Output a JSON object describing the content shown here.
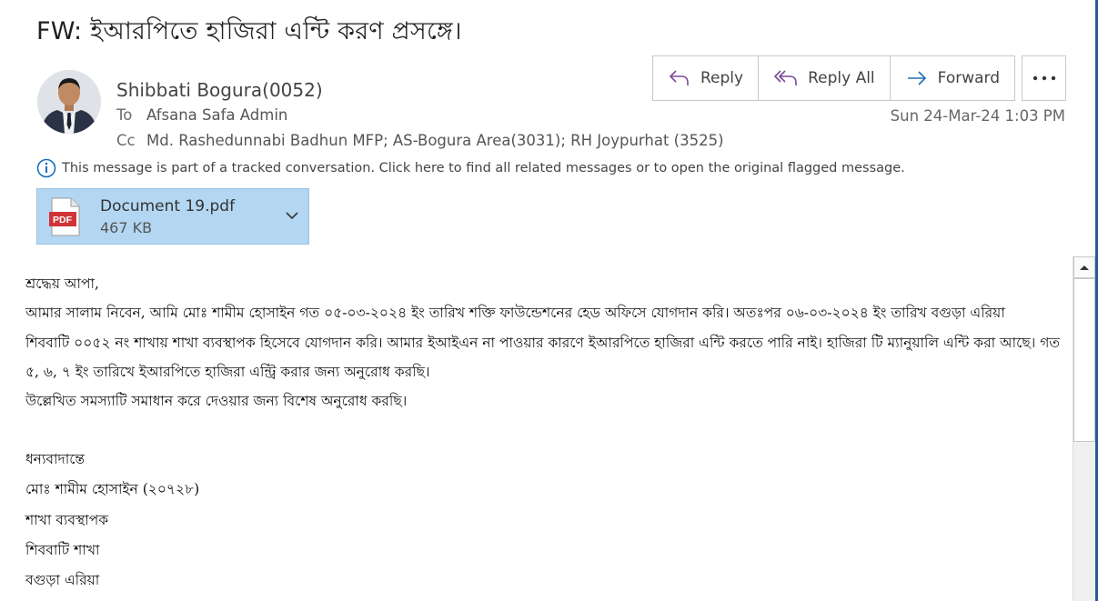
{
  "message": {
    "subject": "FW:  ইআরপিতে হাজিরা এন্টি  করণ প্রসঙ্গে।",
    "sender": "Shibbati  Bogura(0052)",
    "to_label": "To",
    "to": "Afsana Safa Admin",
    "cc_label": "Cc",
    "cc": "Md. Rashedunnabi Badhun MFP; AS-Bogura Area(3031); RH Joypurhat (3525)",
    "date": "Sun 24-Mar-24 1:03 PM",
    "info": "This message is part of a tracked conversation. Click here to find all related messages or to open the original flagged message."
  },
  "actions": {
    "reply": "Reply",
    "reply_all": "Reply All",
    "forward": "Forward"
  },
  "attachment": {
    "name": "Document 19.pdf",
    "size": "467 KB",
    "type_label": "PDF"
  },
  "body": {
    "greeting": "শ্রদ্ধেয় আপা,",
    "line1": "আমার সালাম নিবেন, আমি মোঃ শামীম হোসাইন গত ০৫-০৩-২০২৪ ইং তারিখ  শক্তি ফাউন্ডেশনের হেড অফিসে যোগদান করি। অতঃপর ০৬-০৩-২০২৪ ইং তারিখ বগুড়া এরিয়া",
    "line2": "শিববাটি ০০৫২ নং শাখায় শাখা ব্যবস্থাপক হিসেবে যোগদান করি। আমার ইআইএন না পাওয়ার কারণে ইআরপিতে হাজিরা এন্টি করতে পারি নাই। হাজিরা টি ম্যানুয়ালি এন্টি করা আছে। গত",
    "line3": "৫, ৬, ৭ ইং তারিখে ইআরপিতে হাজিরা এন্ট্রি করার জন্য অনুরোধ করছি।",
    "line4": "উল্লেখিত সমস্যাটি সমাধান করে দেওয়ার জন্য বিশেষ অনুরোধ করছি।",
    "closing": "ধন্যবাদান্তে",
    "sig_name": "মোঃ শামীম হোসাইন (২০৭২৮)",
    "sig_title": "শাখা ব্যবস্থাপক",
    "sig_branch": "শিববাটি শাখা",
    "sig_area": "বগুড়া এরিয়া"
  },
  "colors": {
    "accent": "#2b579a",
    "attachment_bg": "#b3d7f2",
    "pdf_red": "#d13438",
    "info_blue": "#0f6cbd"
  },
  "icons": [
    "reply-icon",
    "reply-all-icon",
    "forward-icon",
    "more-icon",
    "info-icon",
    "pdf-icon",
    "chevron-down-icon",
    "scroll-up-icon"
  ]
}
